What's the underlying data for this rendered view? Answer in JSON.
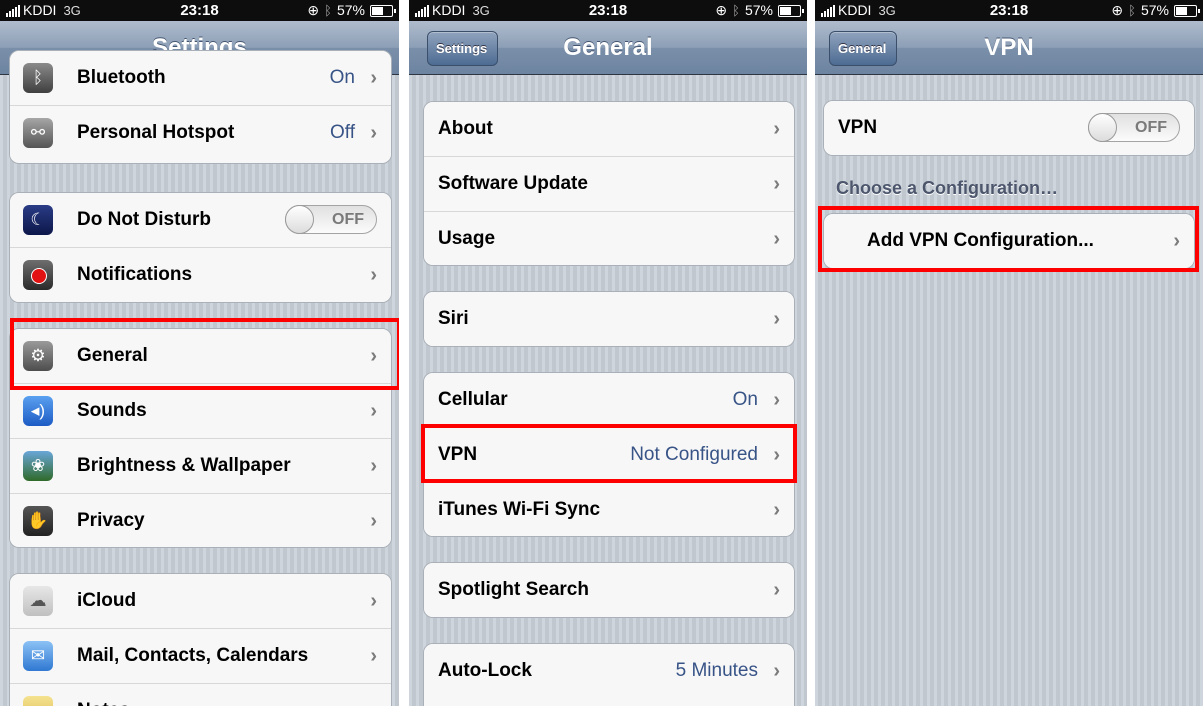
{
  "status": {
    "carrier": "KDDI",
    "network": "3G",
    "time": "23:18",
    "battery": "57%"
  },
  "panel1": {
    "title": "Settings",
    "bluetooth": {
      "label": "Bluetooth",
      "value": "On"
    },
    "group1": [
      {
        "label": "Personal Hotspot",
        "value": "Off",
        "icon": "hotspot-icon"
      }
    ],
    "group2": [
      {
        "label": "Do Not Disturb",
        "toggle": "OFF",
        "icon": "moon-icon"
      },
      {
        "label": "Notifications",
        "icon": "notifications-icon"
      }
    ],
    "group3": [
      {
        "label": "General",
        "icon": "gear-icon"
      },
      {
        "label": "Sounds",
        "icon": "speaker-icon"
      },
      {
        "label": "Brightness & Wallpaper",
        "icon": "flower-icon"
      },
      {
        "label": "Privacy",
        "icon": "hand-icon"
      }
    ],
    "group4": [
      {
        "label": "iCloud",
        "icon": "cloud-icon"
      },
      {
        "label": "Mail, Contacts, Calendars",
        "icon": "mail-icon"
      },
      {
        "label": "Notes",
        "icon": "notes-icon"
      }
    ]
  },
  "panel2": {
    "title": "General",
    "back": "Settings",
    "group1": [
      {
        "label": "About"
      },
      {
        "label": "Software Update"
      },
      {
        "label": "Usage"
      }
    ],
    "group2": [
      {
        "label": "Siri"
      }
    ],
    "group3": [
      {
        "label": "Cellular",
        "value": "On"
      },
      {
        "label": "VPN",
        "value": "Not Configured"
      },
      {
        "label": "iTunes Wi-Fi Sync"
      }
    ],
    "group4": [
      {
        "label": "Spotlight Search"
      }
    ],
    "group5": [
      {
        "label": "Auto-Lock",
        "value": "5 Minutes"
      }
    ]
  },
  "panel3": {
    "title": "VPN",
    "back": "General",
    "vpn_label": "VPN",
    "vpn_toggle": "OFF",
    "section_header": "Choose a Configuration…",
    "add_config": "Add VPN Configuration..."
  },
  "colors": {
    "highlight": "#ff0000",
    "value_blue": "#385487",
    "navbar": "#6d84a1"
  }
}
